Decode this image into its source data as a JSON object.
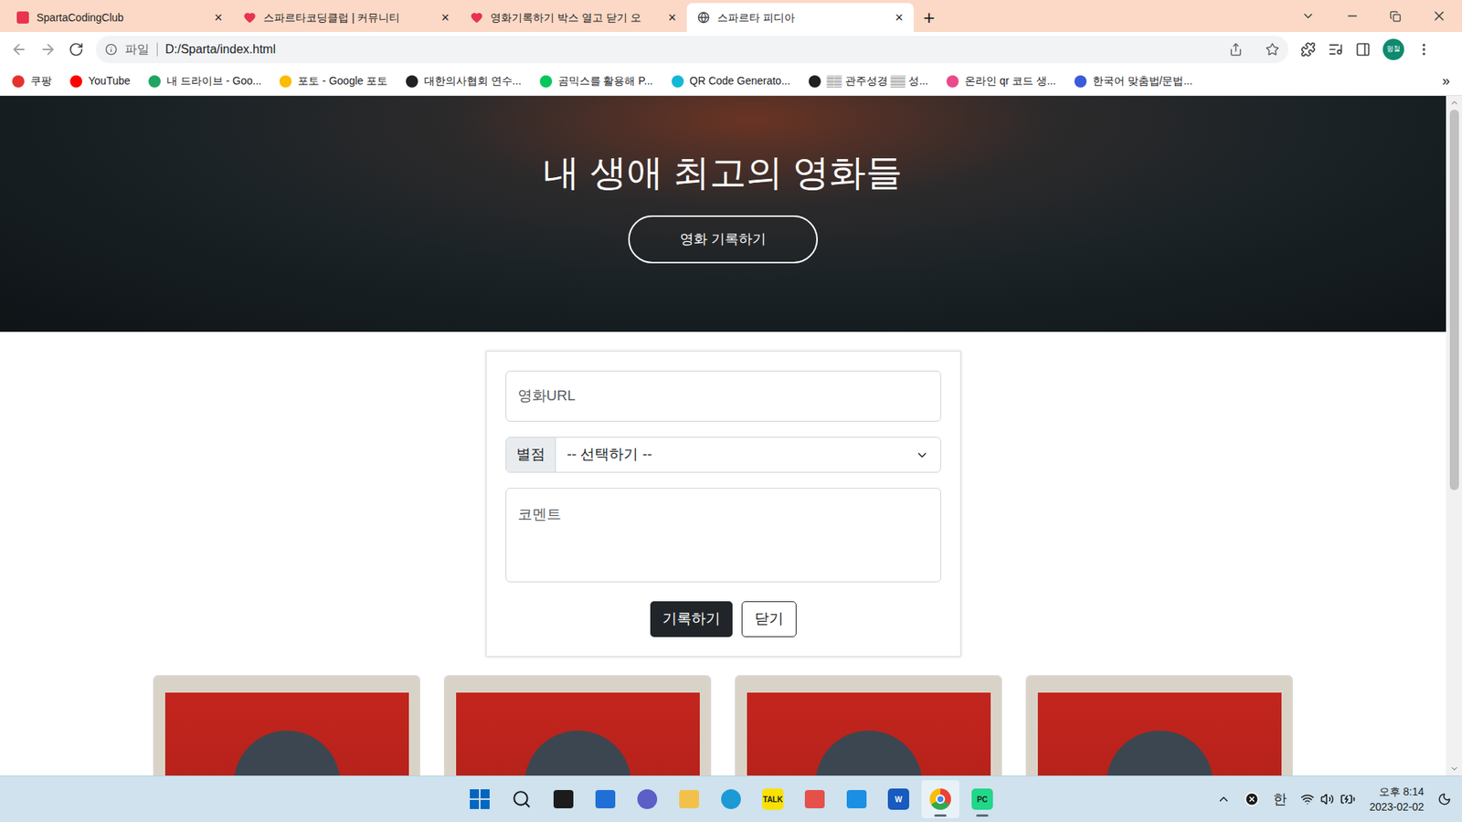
{
  "browser": {
    "tabs": [
      {
        "label": "SpartaCodingClub",
        "close": "×",
        "selected": false,
        "kind": "sparta"
      },
      {
        "label": "스파르타코딩클럽 | 커뮤니티",
        "close": "×",
        "selected": false,
        "kind": "heart"
      },
      {
        "label": "영화기록하기 박스 열고 닫기 오",
        "close": "×",
        "selected": false,
        "kind": "heart"
      },
      {
        "label": "스파르타 피디아",
        "close": "×",
        "selected": true,
        "kind": "globe"
      }
    ],
    "new_tab": "+",
    "address": {
      "scheme": "파일",
      "url": "D:/Sparta/index.html"
    },
    "profile": "형철",
    "bookmarks": [
      {
        "label": "쿠팡",
        "color": "#e5322d"
      },
      {
        "label": "YouTube",
        "color": "#ff0000"
      },
      {
        "label": "내 드라이브 - Goo...",
        "color": "#1fa463"
      },
      {
        "label": "포토 - Google 포토",
        "color": "#fbbc04"
      },
      {
        "label": "대한의사협회 연수...",
        "color": "#202124"
      },
      {
        "label": "곰믹스를 활용해 P...",
        "color": "#03c75a"
      },
      {
        "label": "QR Code Generato...",
        "color": "#14b8d4"
      },
      {
        "label": "▒▒ 관주성경 ▒▒ 성...",
        "color": "#202124"
      },
      {
        "label": "온라인 qr 코드 생...",
        "color": "#e94b8a"
      },
      {
        "label": "한국어 맞춤법/문법...",
        "color": "#3b5bdb"
      }
    ],
    "more_bookmarks": "»"
  },
  "page": {
    "hero": {
      "title": "내 생애 최고의 영화들",
      "button": "영화 기록하기"
    },
    "form": {
      "url_placeholder": "영화URL",
      "rating_label": "별점",
      "rating_value": "-- 선택하기 --",
      "comment_placeholder": "코멘트",
      "submit": "기록하기",
      "close": "닫기"
    },
    "cards": [
      {
        "kind": "poster"
      },
      {
        "kind": "poster"
      },
      {
        "kind": "poster"
      },
      {
        "kind": "poster"
      }
    ]
  },
  "taskbar": {
    "apps": [
      {
        "kind": "start",
        "label": "",
        "color": "#0067c0"
      },
      {
        "kind": "search",
        "label": "",
        "color": "#1b1b1b"
      },
      {
        "kind": "taskview",
        "label": "",
        "color": "#1b1b1b"
      },
      {
        "kind": "widgets",
        "label": "",
        "color": "#1f6fd6"
      },
      {
        "kind": "chat",
        "label": "",
        "color": "#5b5fc7"
      },
      {
        "kind": "folder",
        "label": "",
        "color": "#f2c14b"
      },
      {
        "kind": "edge",
        "label": "",
        "color": "#1c9ad6"
      },
      {
        "kind": "talk",
        "label": "TALK",
        "color": "#fae100"
      },
      {
        "kind": "pdf",
        "label": "",
        "color": "#e5504b"
      },
      {
        "kind": "doc",
        "label": "",
        "color": "#1a8fe3"
      },
      {
        "kind": "word",
        "label": "W",
        "color": "#185abd"
      },
      {
        "kind": "chrome",
        "label": "",
        "color": "#34a853"
      },
      {
        "kind": "pycharm",
        "label": "PC",
        "color": "#21d789"
      }
    ],
    "ime": "한",
    "time": "오후 8:14",
    "date": "2023-02-02"
  }
}
